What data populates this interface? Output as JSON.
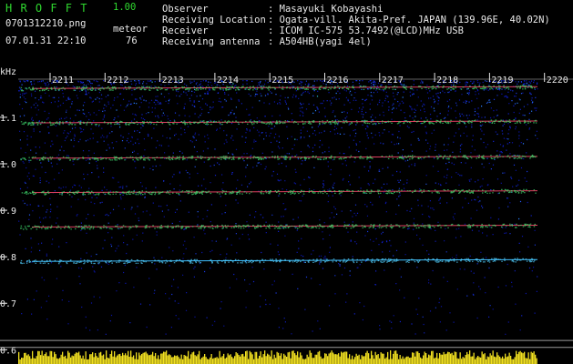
{
  "header": {
    "app_name": "H R O F F T",
    "version": "1.00",
    "filename": "0701312210.png",
    "datetime": "07.01.31 22:10",
    "meteor_label": "meteor",
    "meteor_count": "76",
    "info_rows": [
      {
        "key": "Observer",
        "value": ": Masayuki Kobayashi"
      },
      {
        "key": "Receiving Location",
        "value": ": Ogata-vill. Akita-Pref. JAPAN (139.96E, 40.02N)"
      },
      {
        "key": "Receiver",
        "value": ": ICOM IC-575 53.7492(@LCD)MHz USB"
      },
      {
        "key": "Receiving antenna",
        "value": ": A504HB(yagi 4el)"
      }
    ]
  },
  "chart_data": {
    "type": "heatmap",
    "title": "",
    "ylabel": "kHz",
    "xlabel": "",
    "x_tick_labels": [
      "2211",
      "2212",
      "2213",
      "2214",
      "2215",
      "2216",
      "2217",
      "2218",
      "2219",
      "2220"
    ],
    "y_tick_labels": [
      "1.1",
      "1.0",
      "0.9",
      "0.8",
      "0.7",
      "0.6"
    ],
    "y_ticks": [
      1.1,
      1.0,
      0.9,
      0.8,
      0.7,
      0.6
    ],
    "ylim": [
      0.585,
      1.18
    ],
    "traces": [
      {
        "freq": 1.162,
        "color": "#e04060"
      },
      {
        "freq": 1.088,
        "color": "#e04060"
      },
      {
        "freq": 1.012,
        "color": "#e04060"
      },
      {
        "freq": 0.938,
        "color": "#e04060"
      },
      {
        "freq": 0.864,
        "color": "#e04060"
      },
      {
        "freq": 0.79,
        "color": "#40c0ff"
      }
    ],
    "colors": {
      "background": "#000000",
      "axis": "#e8e8e8",
      "noise": "#1018c8",
      "meteor_bar": "#f0e020"
    }
  }
}
